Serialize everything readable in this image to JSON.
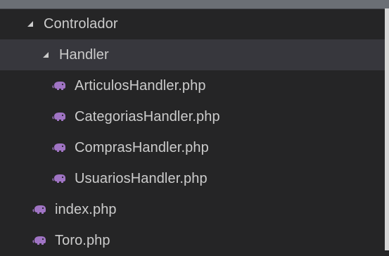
{
  "explorer": {
    "tree": {
      "folder_controlador": {
        "label": "Controlador"
      },
      "folder_handler": {
        "label": "Handler"
      },
      "files_handler": [
        {
          "label": "ArticulosHandler.php"
        },
        {
          "label": "CategoriasHandler.php"
        },
        {
          "label": "ComprasHandler.php"
        },
        {
          "label": "UsuariosHandler.php"
        }
      ],
      "root_files": [
        {
          "label": "index.php"
        },
        {
          "label": "Toro.php"
        }
      ]
    },
    "icons": {
      "php_icon_color": "#a074c4",
      "expanded_icon": "chevron-down-icon"
    },
    "colors": {
      "background": "#252526",
      "selected_row": "#37373d",
      "text": "#cccccc"
    }
  }
}
